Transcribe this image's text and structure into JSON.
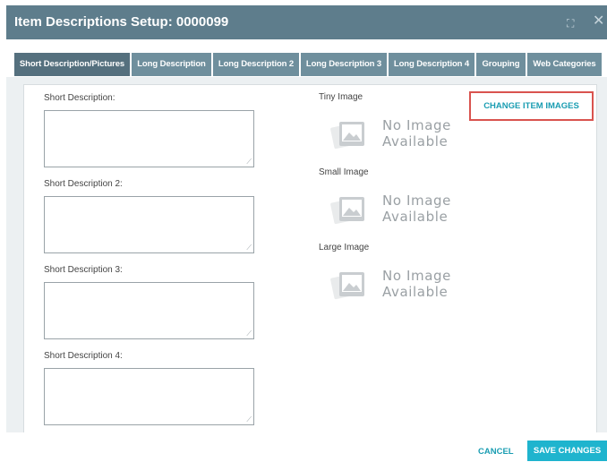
{
  "window": {
    "title": "Item Descriptions Setup: 0000099",
    "maximize_icon": "⛶",
    "close_icon": "✕"
  },
  "tabs": [
    {
      "label": "Short Description/Pictures",
      "active": true
    },
    {
      "label": "Long Description",
      "active": false
    },
    {
      "label": "Long Description 2",
      "active": false
    },
    {
      "label": "Long Description 3",
      "active": false
    },
    {
      "label": "Long Description 4",
      "active": false
    },
    {
      "label": "Grouping",
      "active": false
    },
    {
      "label": "Web Categories",
      "active": false
    }
  ],
  "descriptions": [
    {
      "label": "Short Description:",
      "value": ""
    },
    {
      "label": "Short Description 2:",
      "value": ""
    },
    {
      "label": "Short Description 3:",
      "value": ""
    },
    {
      "label": "Short Description 4:",
      "value": ""
    }
  ],
  "images": [
    {
      "label": "Tiny Image",
      "line1": "No Image",
      "line2": "Available",
      "icon": "photo-placeholder-icon"
    },
    {
      "label": "Small Image",
      "line1": "No Image",
      "line2": "Available",
      "icon": "photo-placeholder-icon"
    },
    {
      "label": "Large Image",
      "line1": "No Image",
      "line2": "Available",
      "icon": "photo-placeholder-icon"
    }
  ],
  "change_images_label": "CHANGE ITEM IMAGES",
  "footer": {
    "cancel_label": "CANCEL",
    "save_label": "SAVE CHANGES"
  },
  "colors": {
    "titlebar": "#5e7d8c",
    "tab": "#6f8f9d",
    "tab_active": "#55707e",
    "accent": "#1fb4ce",
    "highlight_border": "#d9534f"
  }
}
